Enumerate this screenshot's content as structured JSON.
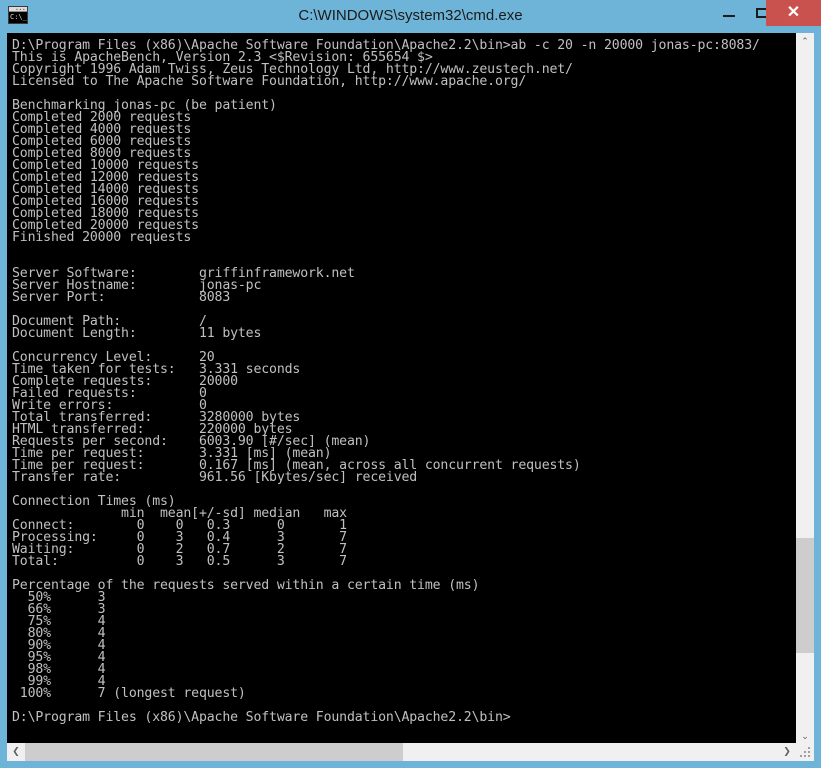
{
  "window": {
    "title": "C:\\WINDOWS\\system32\\cmd.exe",
    "icon_name": "cmd-console-icon",
    "icon_text": "C:\\_",
    "titlebar_color": "#6db4d8",
    "close_button_color": "#c9524f",
    "console_bg": "#000000",
    "console_fg": "#c0c0c0",
    "controls": {
      "minimize_label": "–",
      "maximize_label": "□",
      "close_label": "✕"
    }
  },
  "scrollbars": {
    "vertical": {
      "up_arrow": "⌃",
      "down_arrow": "⌄"
    },
    "horizontal": {
      "left_arrow": "❮",
      "right_arrow": "❯"
    }
  },
  "console": {
    "command_line": "D:\\Program Files (x86)\\Apache Software Foundation\\Apache2.2\\bin>ab -c 20 -n 20000 jonas-pc:8083/",
    "banner": [
      "This is ApacheBench, Version 2.3 <$Revision: 655654 $>",
      "Copyright 1996 Adam Twiss, Zeus Technology Ltd, http://www.zeustech.net/",
      "Licensed to The Apache Software Foundation, http://www.apache.org/"
    ],
    "progress": [
      "Benchmarking jonas-pc (be patient)",
      "Completed 2000 requests",
      "Completed 4000 requests",
      "Completed 6000 requests",
      "Completed 8000 requests",
      "Completed 10000 requests",
      "Completed 12000 requests",
      "Completed 14000 requests",
      "Completed 16000 requests",
      "Completed 18000 requests",
      "Completed 20000 requests",
      "Finished 20000 requests"
    ],
    "server_info": [
      "Server Software:        griffinframework.net",
      "Server Hostname:        jonas-pc",
      "Server Port:            8083"
    ],
    "document_info": [
      "Document Path:          /",
      "Document Length:        11 bytes"
    ],
    "summary": [
      "Concurrency Level:      20",
      "Time taken for tests:   3.331 seconds",
      "Complete requests:      20000",
      "Failed requests:        0",
      "Write errors:           0",
      "Total transferred:      3280000 bytes",
      "HTML transferred:       220000 bytes",
      "Requests per second:    6003.90 [#/sec] (mean)",
      "Time per request:       3.331 [ms] (mean)",
      "Time per request:       0.167 [ms] (mean, across all concurrent requests)",
      "Transfer rate:          961.56 [Kbytes/sec] received"
    ],
    "connection_times_title": "Connection Times (ms)",
    "connection_times": [
      "              min  mean[+/-sd] median   max",
      "Connect:        0    0   0.3      0       1",
      "Processing:     0    3   0.4      3       7",
      "Waiting:        0    2   0.7      2       7",
      "Total:          0    3   0.5      3       7"
    ],
    "percentile_title": "Percentage of the requests served within a certain time (ms)",
    "percentiles": [
      "  50%      3",
      "  66%      3",
      "  75%      4",
      "  80%      4",
      "  90%      4",
      "  95%      4",
      "  98%      4",
      "  99%      4",
      " 100%      7 (longest request)"
    ],
    "final_prompt": "D:\\Program Files (x86)\\Apache Software Foundation\\Apache2.2\\bin>"
  },
  "stats_data": {
    "server_software": "griffinframework.net",
    "server_hostname": "jonas-pc",
    "server_port": "8083",
    "document_path": "/",
    "document_length": "11 bytes",
    "concurrency_level": "20",
    "time_taken_for_tests": "3.331 seconds",
    "complete_requests": "20000",
    "failed_requests": "0",
    "write_errors": "0",
    "total_transferred": "3280000 bytes",
    "html_transferred": "220000 bytes",
    "requests_per_second": "6003.90 [#/sec] (mean)",
    "time_per_request_mean": "3.331 [ms] (mean)",
    "time_per_request_all": "0.167 [ms] (mean, across all concurrent requests)",
    "transfer_rate": "961.56 [Kbytes/sec] received",
    "connection_time_rows": [
      {
        "label": "Connect:",
        "min": "0",
        "mean": "0",
        "sd": "0.3",
        "median": "0",
        "max": "1"
      },
      {
        "label": "Processing:",
        "min": "0",
        "mean": "3",
        "sd": "0.4",
        "median": "3",
        "max": "7"
      },
      {
        "label": "Waiting:",
        "min": "0",
        "mean": "2",
        "sd": "0.7",
        "median": "2",
        "max": "7"
      },
      {
        "label": "Total:",
        "min": "0",
        "mean": "3",
        "sd": "0.5",
        "median": "3",
        "max": "7"
      }
    ],
    "percentile_rows": [
      {
        "pct": "50%",
        "ms": "3",
        "note": ""
      },
      {
        "pct": "66%",
        "ms": "3",
        "note": ""
      },
      {
        "pct": "75%",
        "ms": "4",
        "note": ""
      },
      {
        "pct": "80%",
        "ms": "4",
        "note": ""
      },
      {
        "pct": "90%",
        "ms": "4",
        "note": ""
      },
      {
        "pct": "95%",
        "ms": "4",
        "note": ""
      },
      {
        "pct": "98%",
        "ms": "4",
        "note": ""
      },
      {
        "pct": "99%",
        "ms": "4",
        "note": ""
      },
      {
        "pct": "100%",
        "ms": "7",
        "note": "(longest request)"
      }
    ]
  }
}
